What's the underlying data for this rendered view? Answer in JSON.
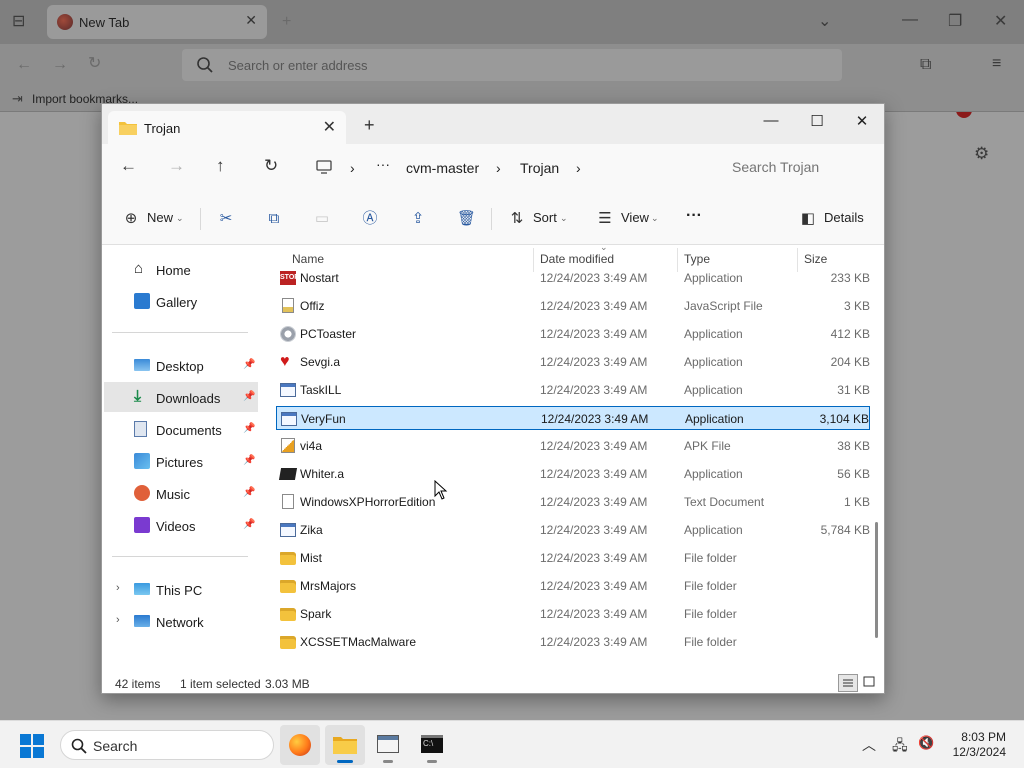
{
  "browser": {
    "tab_title": "New Tab",
    "address_placeholder": "Search or enter address",
    "bookmark_label": "Import bookmarks..."
  },
  "explorer": {
    "tab_title": "Trojan",
    "breadcrumb": [
      "cvm-master",
      "Trojan"
    ],
    "search_placeholder": "Search Trojan",
    "commands": {
      "new": "New",
      "sort": "Sort",
      "view": "View",
      "details": "Details"
    },
    "sidebar": {
      "home": "Home",
      "gallery": "Gallery",
      "quick": [
        {
          "label": "Desktop",
          "icon": "desktop-icon"
        },
        {
          "label": "Downloads",
          "icon": "download-icon"
        },
        {
          "label": "Documents",
          "icon": "documents-icon"
        },
        {
          "label": "Pictures",
          "icon": "pictures-icon"
        },
        {
          "label": "Music",
          "icon": "music-icon"
        },
        {
          "label": "Videos",
          "icon": "videos-icon"
        }
      ],
      "this_pc": "This PC",
      "network": "Network",
      "active_item": "Downloads"
    },
    "columns": {
      "name": "Name",
      "date": "Date modified",
      "type": "Type",
      "size": "Size"
    },
    "files": [
      {
        "name": "Nostart",
        "date": "12/24/2023 3:49 AM",
        "type": "Application",
        "size": "233 KB",
        "icon": "stop-icon"
      },
      {
        "name": "Offiz",
        "date": "12/24/2023 3:49 AM",
        "type": "JavaScript File",
        "size": "3 KB",
        "icon": "javascript-file-icon"
      },
      {
        "name": "PCToaster",
        "date": "12/24/2023 3:49 AM",
        "type": "Application",
        "size": "412 KB",
        "icon": "gear-icon"
      },
      {
        "name": "Sevgi.a",
        "date": "12/24/2023 3:49 AM",
        "type": "Application",
        "size": "204 KB",
        "icon": "heart-icon"
      },
      {
        "name": "TaskILL",
        "date": "12/24/2023 3:49 AM",
        "type": "Application",
        "size": "31 KB",
        "icon": "application-icon"
      },
      {
        "name": "VeryFun",
        "date": "12/24/2023 3:49 AM",
        "type": "Application",
        "size": "3,104 KB",
        "icon": "application-icon"
      },
      {
        "name": "vi4a",
        "date": "12/24/2023 3:49 AM",
        "type": "APK File",
        "size": "38 KB",
        "icon": "apk-file-icon"
      },
      {
        "name": "Whiter.a",
        "date": "12/24/2023 3:49 AM",
        "type": "Application",
        "size": "56 KB",
        "icon": "tape-icon"
      },
      {
        "name": "WindowsXPHorrorEdition",
        "date": "12/24/2023 3:49 AM",
        "type": "Text Document",
        "size": "1 KB",
        "icon": "text-document-icon"
      },
      {
        "name": "Zika",
        "date": "12/24/2023 3:49 AM",
        "type": "Application",
        "size": "5,784 KB",
        "icon": "application-icon"
      },
      {
        "name": "Mist",
        "date": "12/24/2023 3:49 AM",
        "type": "File folder",
        "size": "",
        "icon": "folder-icon"
      },
      {
        "name": "MrsMajors",
        "date": "12/24/2023 3:49 AM",
        "type": "File folder",
        "size": "",
        "icon": "folder-icon"
      },
      {
        "name": "Spark",
        "date": "12/24/2023 3:49 AM",
        "type": "File folder",
        "size": "",
        "icon": "folder-icon"
      },
      {
        "name": "XCSSETMacMalware",
        "date": "12/24/2023 3:49 AM",
        "type": "File folder",
        "size": "",
        "icon": "folder-icon"
      }
    ],
    "selected_file": "VeryFun",
    "status": {
      "item_count": "42 items",
      "selection": "1 item selected",
      "selection_size": "3.03 MB"
    }
  },
  "taskbar": {
    "search_label": "Search",
    "time": "8:03 PM",
    "date": "12/3/2024"
  },
  "colors": {
    "selection_fill": "#cce8ff",
    "selection_border": "#0067c0",
    "folder": "#f3c23c",
    "accent": "#0067c0"
  }
}
